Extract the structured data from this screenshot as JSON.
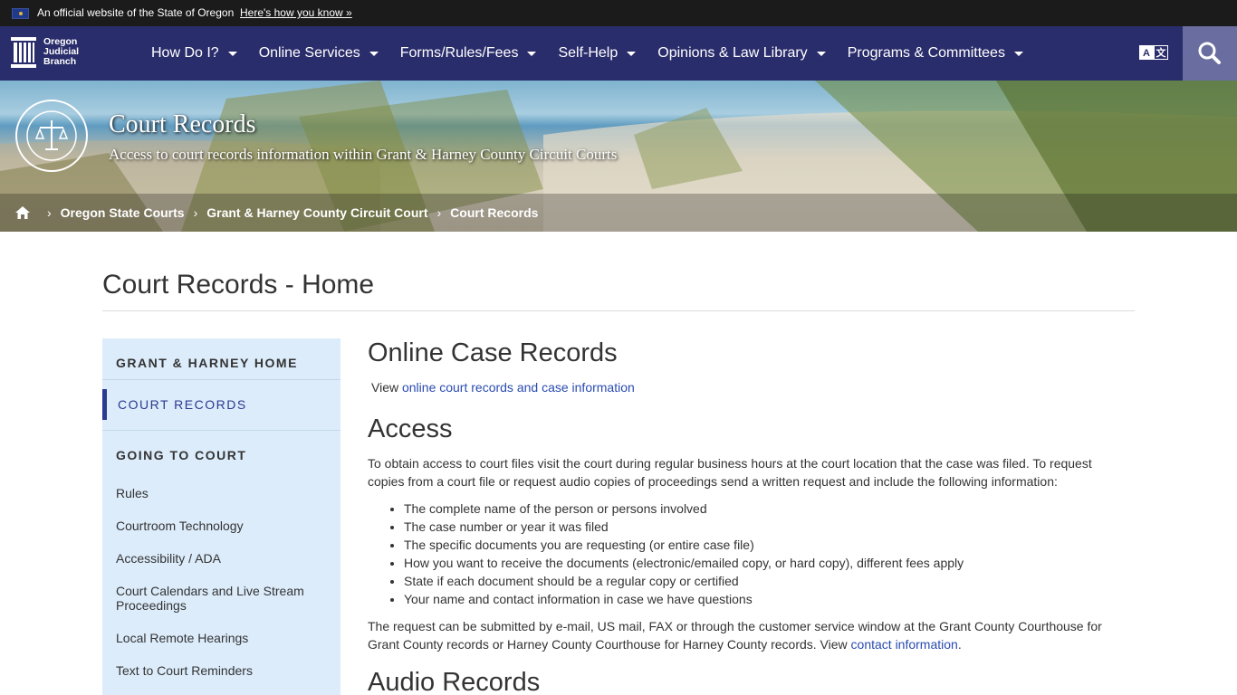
{
  "gov_banner": {
    "text": "An official website of the State of Oregon",
    "link": "Here's how you know »"
  },
  "header": {
    "logo_line1": "Oregon",
    "logo_line2": "Judicial",
    "logo_line3": "Branch",
    "nav": [
      {
        "label": "How Do I?"
      },
      {
        "label": "Online Services"
      },
      {
        "label": "Forms/Rules/Fees"
      },
      {
        "label": "Self-Help"
      },
      {
        "label": "Opinions & Law Library"
      },
      {
        "label": "Programs & Committees"
      }
    ],
    "translate_glyph_a": "A",
    "translate_glyph_b": "文"
  },
  "hero": {
    "title": "Court Records",
    "subtitle": "Access to court records information within Grant & Harney County Circuit Courts",
    "breadcrumb": [
      "Oregon State Courts",
      "Grant & Harney County Circuit Court",
      "Court Records"
    ]
  },
  "page": {
    "title": "Court Records - Home"
  },
  "sidebar": {
    "home": "GRANT & HARNEY HOME",
    "active": "COURT RECORDS",
    "section": "GOING TO COURT",
    "links": [
      "Rules",
      "Courtroom Technology",
      "Accessibility / ADA",
      "Court Calendars and Live Stream Proceedings",
      "Local Remote Hearings",
      "Text to Court Reminders"
    ]
  },
  "main": {
    "online_heading": "Online Case Records",
    "online_prefix": "View ",
    "online_link": "online court records and case information",
    "access_heading": "Access",
    "access_para": "To obtain access to court files visit the court during regular business hours at the court location that the case was filed.  To request copies from a court file or request audio copies of proceedings send a written request and include the following information:",
    "bullets": [
      "The complete name of the person or persons involved",
      "The case number or year it was filed",
      "The specific documents you are requesting (or entire case file)",
      "How you want to receive the documents (electronic/emailed copy, or hard copy), different fees apply",
      "State if each document should be a regular copy or certified",
      "Your name and contact information in case we have questions"
    ],
    "request_para": "The request can be submitted by e-mail, US mail, FAX or through the customer service window at the Grant County Courthouse for Grant County records or Harney County Courthouse for Harney County records.  View ",
    "contact_link": "contact information",
    "contact_suffix": ".",
    "audio_heading": "Audio Records"
  },
  "colors": {
    "nav_bg": "#2a2d6b",
    "sidebar_bg": "#dcecfb",
    "link": "#2a4bb0",
    "active_bar": "#2a3a8f"
  }
}
